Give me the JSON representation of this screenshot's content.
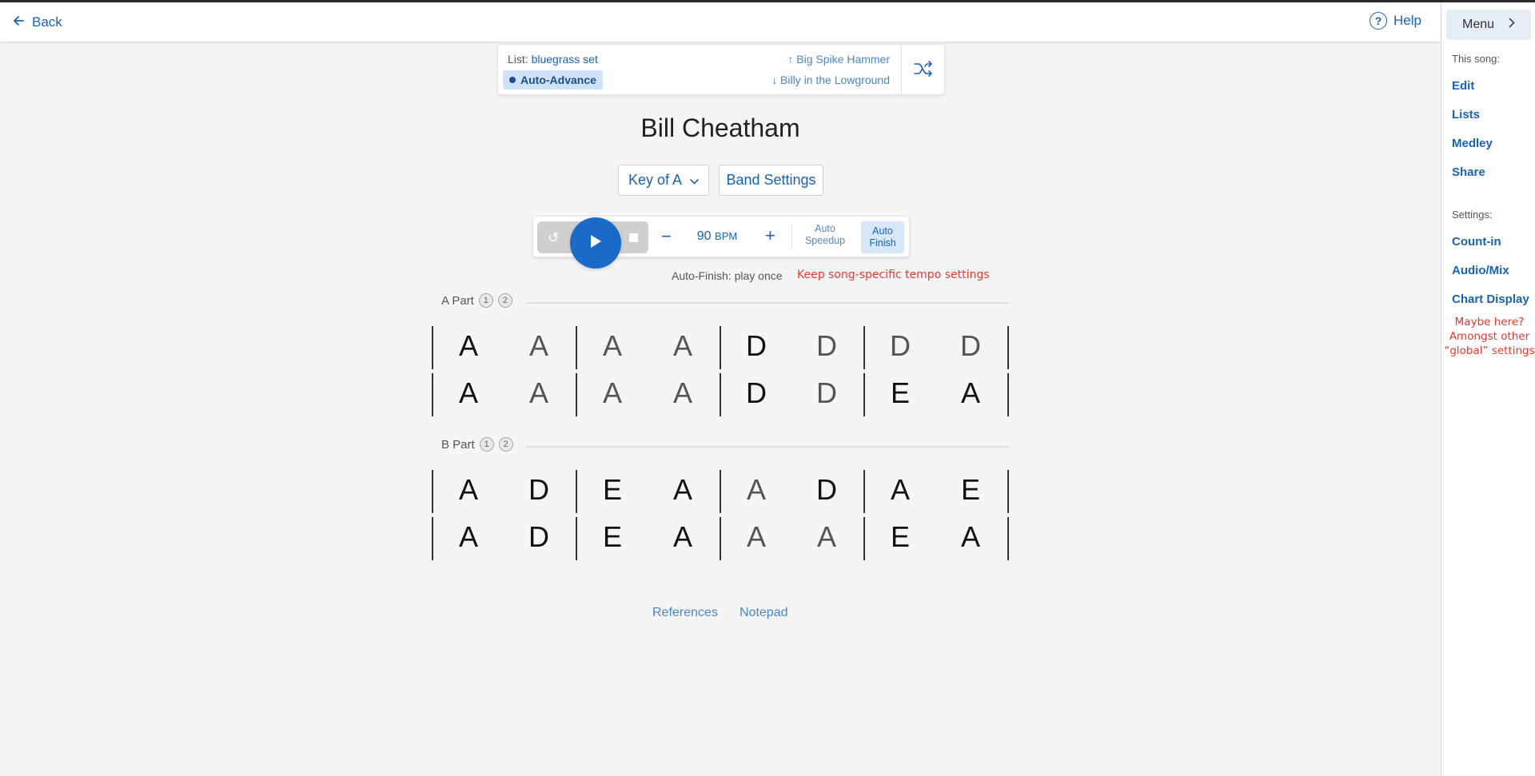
{
  "header": {
    "back_label": "Back",
    "help_label": "Help"
  },
  "sidebar": {
    "menu_label": "Menu",
    "this_song_heading": "This song:",
    "song_links": [
      "Edit",
      "Lists",
      "Medley",
      "Share"
    ],
    "settings_heading": "Settings:",
    "settings_links": [
      "Count-in",
      "Audio/Mix",
      "Chart Display"
    ],
    "annotation": "Maybe here? Amongst other “global” settings"
  },
  "list_bar": {
    "list_prefix": "List:",
    "list_name": "bluegrass set",
    "auto_advance": "Auto-Advance",
    "prev_song": "Big Spike Hammer",
    "next_song": "Billy in the Lowground"
  },
  "song": {
    "title": "Bill Cheatham",
    "key_label": "Key of A",
    "band_settings_label": "Band Settings"
  },
  "player": {
    "bpm": "90",
    "bpm_unit": "BPM",
    "auto_speedup_line1": "Auto",
    "auto_speedup_line2": "Speedup",
    "auto_finish_line1": "Auto",
    "auto_finish_line2": "Finish",
    "auto_finish_active": true,
    "status": "Auto-Finish: play once",
    "annotation": "Keep song-specific tempo settings"
  },
  "parts": [
    {
      "label": "A Part",
      "repeats": [
        "1",
        "2"
      ],
      "rows": [
        [
          "A",
          "A",
          "A",
          "A",
          "D",
          "D",
          "D",
          "D"
        ],
        [
          "A",
          "A",
          "A",
          "A",
          "D",
          "D",
          "E",
          "A"
        ]
      ]
    },
    {
      "label": "B Part",
      "repeats": [
        "1",
        "2"
      ],
      "rows": [
        [
          "A",
          "D",
          "E",
          "A",
          "A",
          "D",
          "A",
          "E"
        ],
        [
          "A",
          "D",
          "E",
          "A",
          "A",
          "A",
          "E",
          "A"
        ]
      ]
    }
  ],
  "footer": {
    "references_label": "References",
    "notepad_label": "Notepad"
  },
  "colors": {
    "accent": "#1a62b4",
    "annotation_red": "#e8382e",
    "play_button": "#1a6bc8"
  }
}
